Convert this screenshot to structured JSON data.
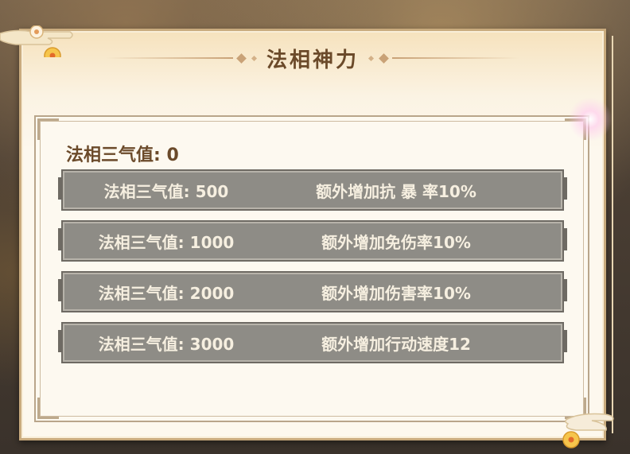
{
  "dialog": {
    "title": "法相神力",
    "current_label": "法相三气值: 0"
  },
  "tiers": [
    {
      "threshold": "法相三气值: 500",
      "effect": "额外增加抗 暴 率10%"
    },
    {
      "threshold": "法相三气值: 1000",
      "effect": "额外增加免伤率10%"
    },
    {
      "threshold": "法相三气值: 2000",
      "effect": "额外增加伤害率10%"
    },
    {
      "threshold": "法相三气值: 3000",
      "effect": "额外增加行动速度12"
    }
  ],
  "decorations": {
    "flower_icon": "plum-blossom-icon",
    "cloud_icon": "auspicious-cloud-icon"
  }
}
